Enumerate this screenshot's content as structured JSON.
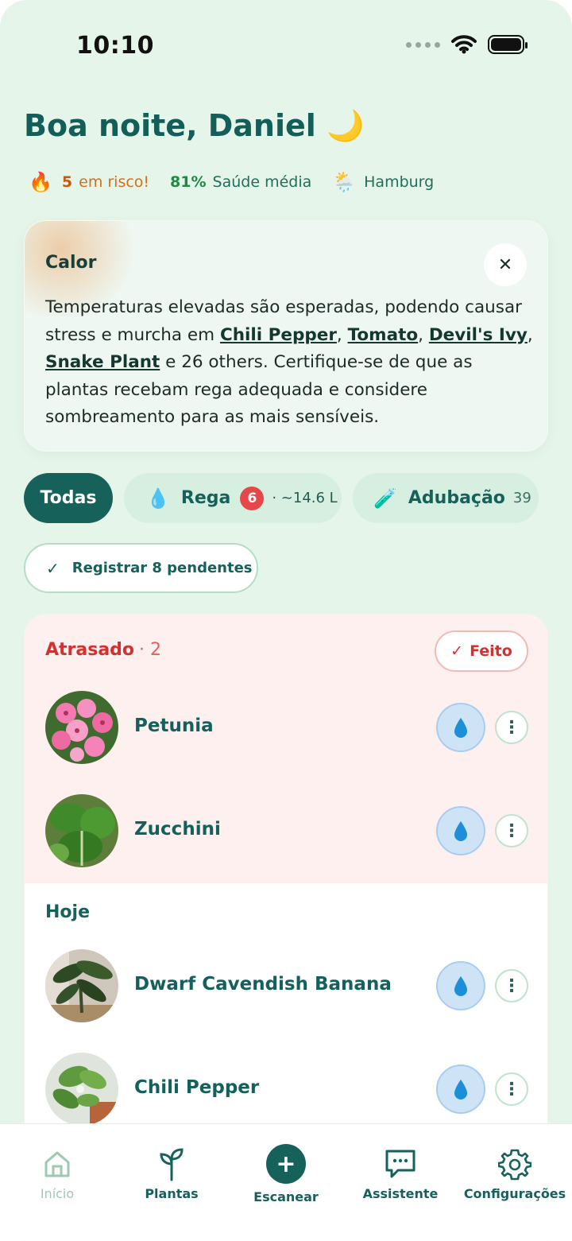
{
  "status_bar": {
    "time": "10:10"
  },
  "header": {
    "greeting": "Boa noite, Daniel 🌙",
    "risk_count": "5",
    "risk_label": "em risco!",
    "health_value": "81%",
    "health_label": "Saúde média",
    "location": "Hamburg"
  },
  "alert": {
    "title": "Calor",
    "text_1": "Temperaturas elevadas são esperadas, podendo causar stress e murcha em ",
    "plant_1": "Chili Pepper",
    "sep_1": ", ",
    "plant_2": "Tomato",
    "sep_2": ", ",
    "plant_3": "Devil's Ivy",
    "sep_3": ", ",
    "plant_4": "Snake Plant",
    "text_2": " e 26 others. Certifique-se de que as plantas recebam rega adequada e considere sombreamento para as mais sensíveis.",
    "close_symbol": "✕"
  },
  "filters": {
    "all_label": "Todas",
    "water_label": "Rega",
    "water_badge": "6",
    "water_amount": "· ~14.6 L",
    "fert_label": "Adubação",
    "fert_count": "39"
  },
  "register_label": "Registrar 8 pendentes",
  "overdue": {
    "title": "Atrasado",
    "count": "· 2",
    "done_label": "Feito",
    "items": [
      {
        "name": "Petunia"
      },
      {
        "name": "Zucchini"
      }
    ]
  },
  "today": {
    "title": "Hoje",
    "items": [
      {
        "name": "Dwarf Cavendish Banana"
      },
      {
        "name": "Chili Pepper"
      }
    ]
  },
  "nav": {
    "home": "Início",
    "plants": "Plantas",
    "scan": "Escanear",
    "assistant": "Assistente",
    "settings": "Configurações"
  },
  "colors": {
    "primary": "#17615b",
    "background": "#e6f5ea",
    "overdue_bg": "#fdf0ef",
    "overdue_red": "#d3312f",
    "water_blue": "#cfe3f7",
    "badge_red": "#e44848"
  }
}
